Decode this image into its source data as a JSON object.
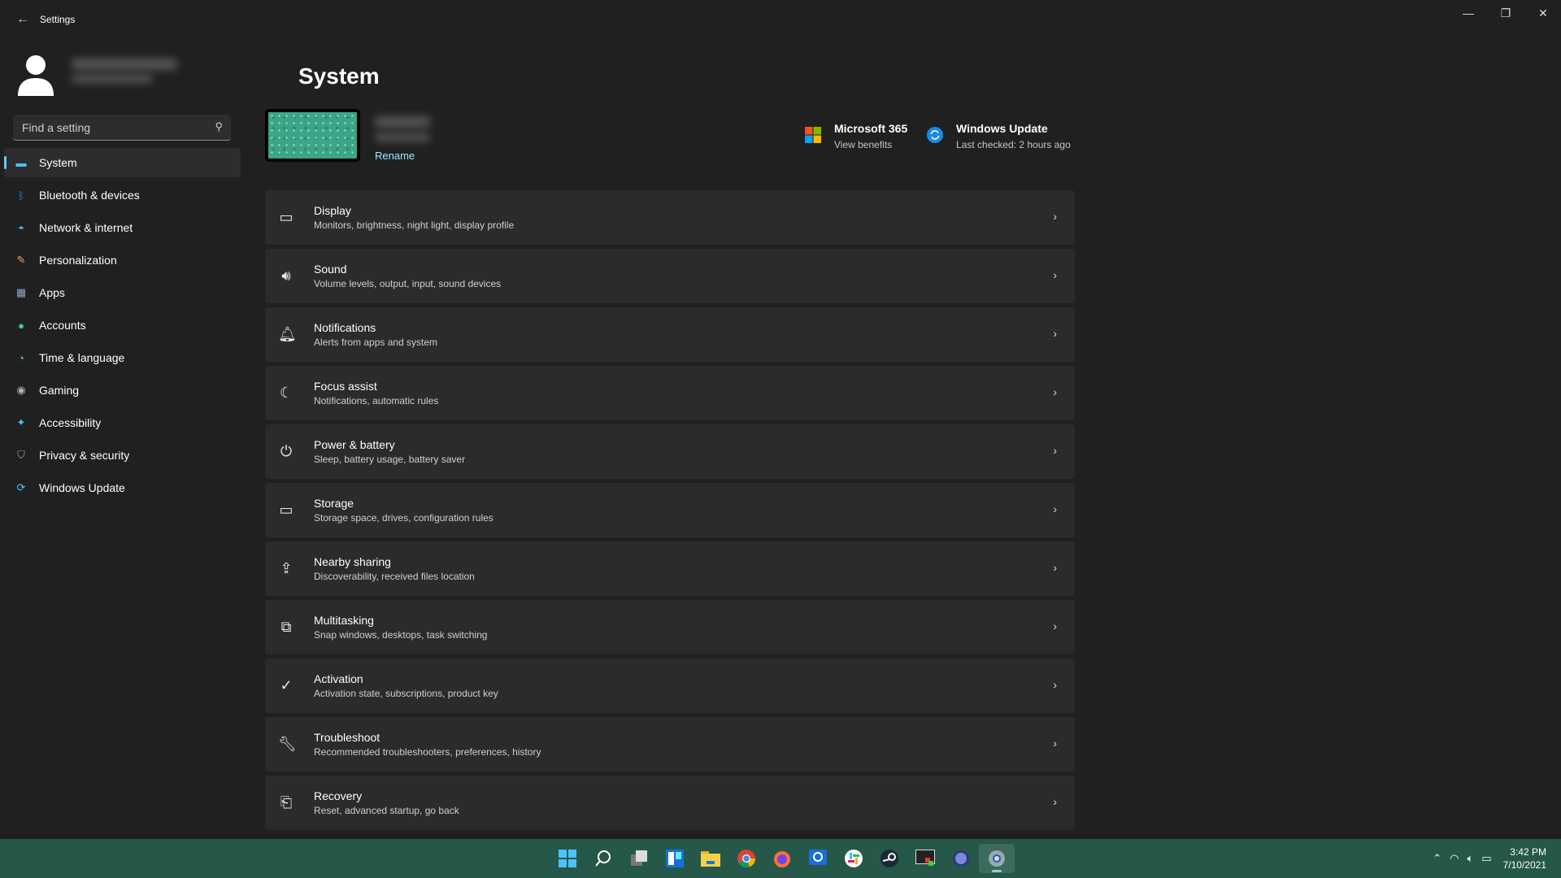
{
  "window": {
    "title": "Settings",
    "back_icon": "arrow-left-icon",
    "minimize": "—",
    "maximize": "❐",
    "close": "✕"
  },
  "sidebar": {
    "search_placeholder": "Find a setting",
    "items": [
      {
        "label": "System",
        "icon": "monitor-icon",
        "color": "#4cc2ff",
        "active": true
      },
      {
        "label": "Bluetooth & devices",
        "icon": "bluetooth-icon",
        "color": "#1e90ff"
      },
      {
        "label": "Network & internet",
        "icon": "wifi-icon",
        "color": "#4cc2ff"
      },
      {
        "label": "Personalization",
        "icon": "brush-icon",
        "color": "#f0a060"
      },
      {
        "label": "Apps",
        "icon": "apps-icon",
        "color": "#8aa8c8"
      },
      {
        "label": "Accounts",
        "icon": "person-icon",
        "color": "#3cc8a0"
      },
      {
        "label": "Time & language",
        "icon": "globe-clock-icon",
        "color": "#4cc2ff"
      },
      {
        "label": "Gaming",
        "icon": "gamepad-icon",
        "color": "#b0b0b0"
      },
      {
        "label": "Accessibility",
        "icon": "accessibility-icon",
        "color": "#4cc2ff"
      },
      {
        "label": "Privacy & security",
        "icon": "shield-icon",
        "color": "#a0a0a0"
      },
      {
        "label": "Windows Update",
        "icon": "update-icon",
        "color": "#4cc2ff"
      }
    ]
  },
  "main": {
    "title": "System",
    "rename": "Rename",
    "quick_links": [
      {
        "title": "Microsoft 365",
        "subtitle": "View benefits",
        "icon": "microsoft-logo-icon"
      },
      {
        "title": "Windows Update",
        "subtitle": "Last checked: 2 hours ago",
        "icon": "sync-icon"
      }
    ],
    "cards": [
      {
        "title": "Display",
        "subtitle": "Monitors, brightness, night light, display profile",
        "icon": "laptop-icon"
      },
      {
        "title": "Sound",
        "subtitle": "Volume levels, output, input, sound devices",
        "icon": "speaker-icon"
      },
      {
        "title": "Notifications",
        "subtitle": "Alerts from apps and system",
        "icon": "bell-icon"
      },
      {
        "title": "Focus assist",
        "subtitle": "Notifications, automatic rules",
        "icon": "moon-icon"
      },
      {
        "title": "Power & battery",
        "subtitle": "Sleep, battery usage, battery saver",
        "icon": "power-icon"
      },
      {
        "title": "Storage",
        "subtitle": "Storage space, drives, configuration rules",
        "icon": "drive-icon"
      },
      {
        "title": "Nearby sharing",
        "subtitle": "Discoverability, received files location",
        "icon": "share-icon"
      },
      {
        "title": "Multitasking",
        "subtitle": "Snap windows, desktops, task switching",
        "icon": "windows-stack-icon"
      },
      {
        "title": "Activation",
        "subtitle": "Activation state, subscriptions, product key",
        "icon": "check-circle-icon"
      },
      {
        "title": "Troubleshoot",
        "subtitle": "Recommended troubleshooters, preferences, history",
        "icon": "wrench-icon"
      },
      {
        "title": "Recovery",
        "subtitle": "Reset, advanced startup, go back",
        "icon": "recovery-icon"
      }
    ]
  },
  "taskbar": {
    "apps": [
      "start",
      "search",
      "task-view",
      "widgets",
      "file-explorer",
      "chrome",
      "firefox",
      "signal",
      "slack",
      "steam",
      "terminal",
      "app",
      "settings"
    ],
    "time": "3:42 PM",
    "date": "7/10/2021",
    "color": "#255848"
  }
}
